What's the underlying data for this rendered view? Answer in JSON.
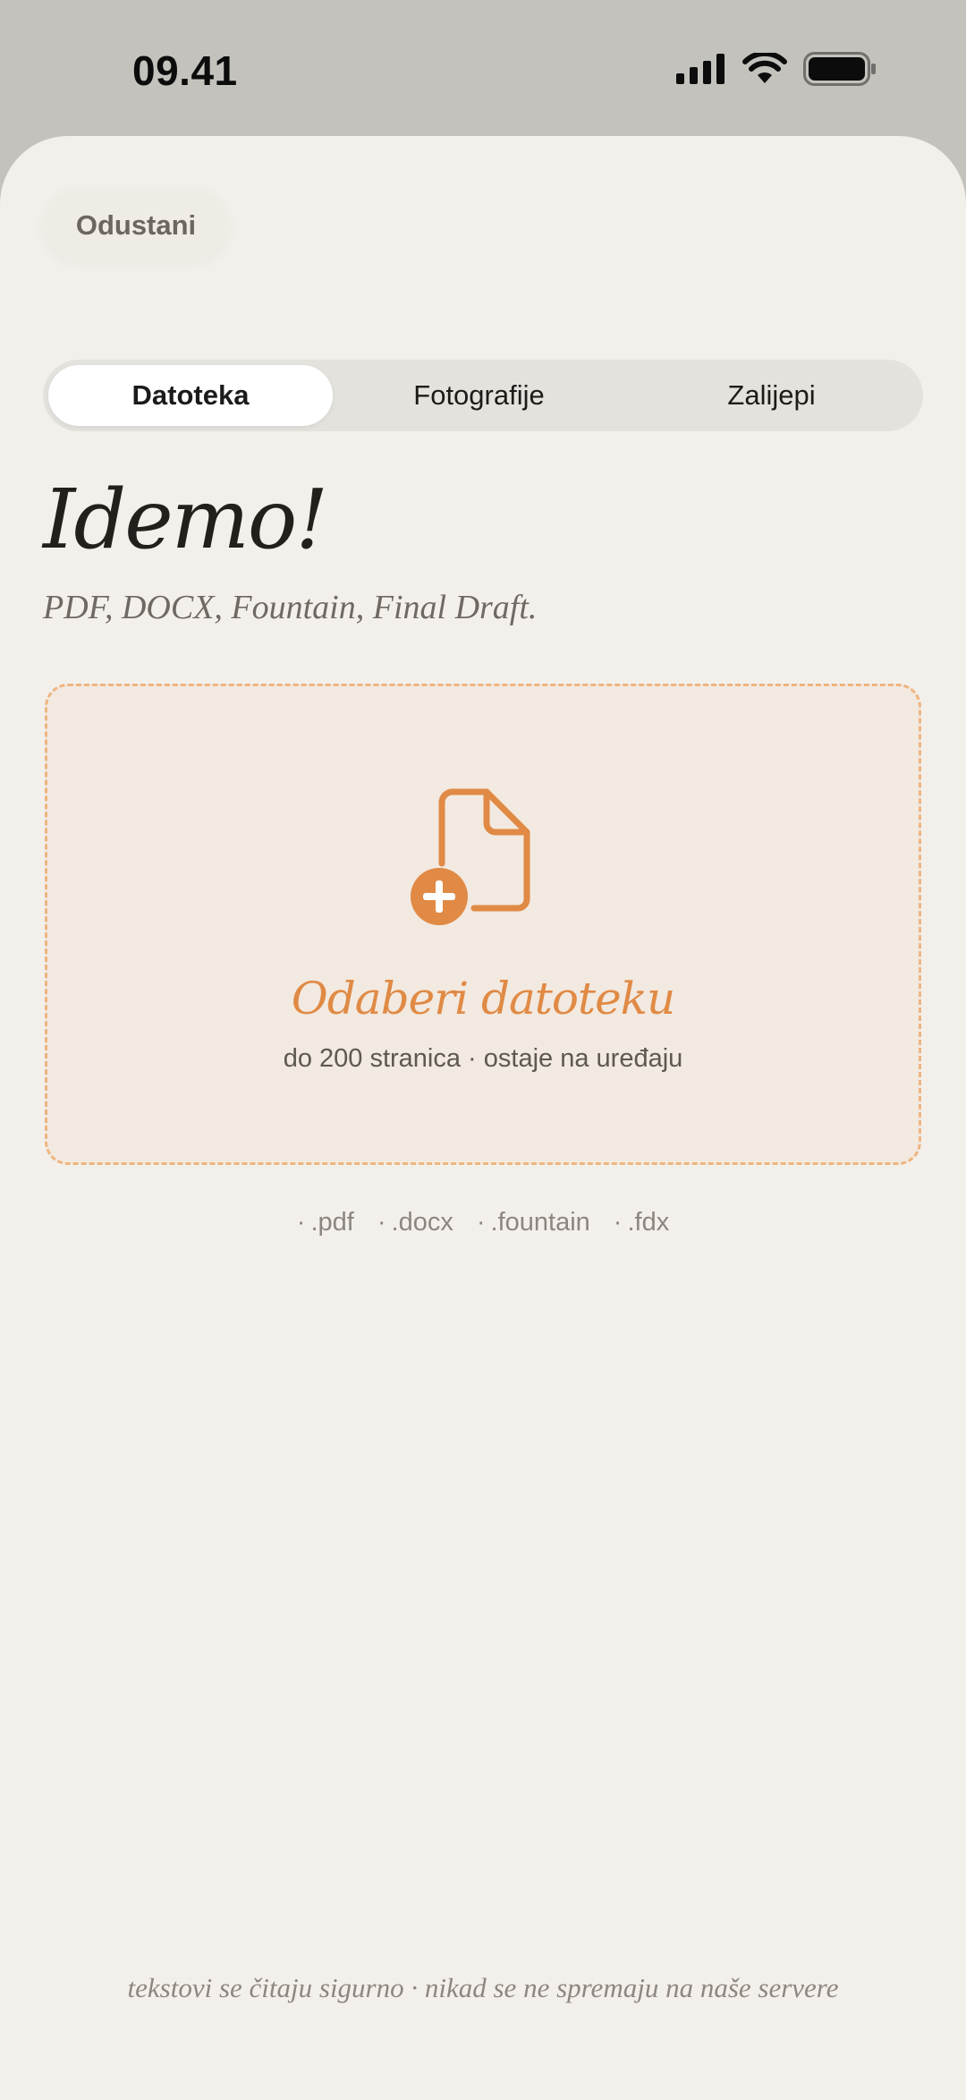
{
  "status_bar": {
    "time": "09.41",
    "icons": [
      "cellular-signal-icon",
      "wifi-icon",
      "battery-icon"
    ]
  },
  "header": {
    "cancel_label": "Odustani"
  },
  "tabs": [
    {
      "label": "Datoteka",
      "active": true
    },
    {
      "label": "Fotografije",
      "active": false
    },
    {
      "label": "Zalijepi",
      "active": false
    }
  ],
  "main": {
    "headline": "Idemo!",
    "subheadline": "PDF, DOCX, Fountain, Final Draft."
  },
  "dropzone": {
    "icon": "file-add-icon",
    "title": "Odaberi datoteku",
    "subtitle": "do 200 stranica · ostaje na uređaju"
  },
  "formats": [
    ".pdf",
    ".docx",
    ".fountain",
    ".fdx"
  ],
  "footer": {
    "note": "tekstovi se čitaju sigurno · nikad se ne spremaju na naše servere"
  },
  "colors": {
    "accent": "#e08a45",
    "dropzone_border": "#efb580",
    "sheet_background": "#f3f0eb",
    "backdrop": "#c3c2bd"
  }
}
